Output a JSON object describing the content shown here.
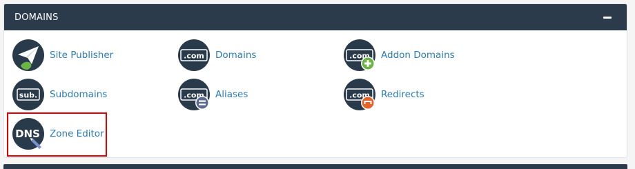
{
  "section": {
    "title": "DOMAINS"
  },
  "items": [
    {
      "label": "Site Publisher"
    },
    {
      "label": "Domains",
      "badge": ".com"
    },
    {
      "label": "Addon Domains",
      "badge": ".com"
    },
    {
      "label": "Subdomains",
      "badge": "sub."
    },
    {
      "label": "Aliases",
      "badge": ".com"
    },
    {
      "label": "Redirects",
      "badge": ".com"
    },
    {
      "label": "Zone Editor",
      "badge": "DNS"
    }
  ],
  "colors": {
    "header_bg": "#2b3b4c",
    "link": "#2b7bb8",
    "icon_bg": "#293a4a",
    "add_badge": "#6bb544",
    "remove_badge": "#5c6b8e",
    "redirect_badge": "#e8632a",
    "selection_outline": "#e10000"
  }
}
